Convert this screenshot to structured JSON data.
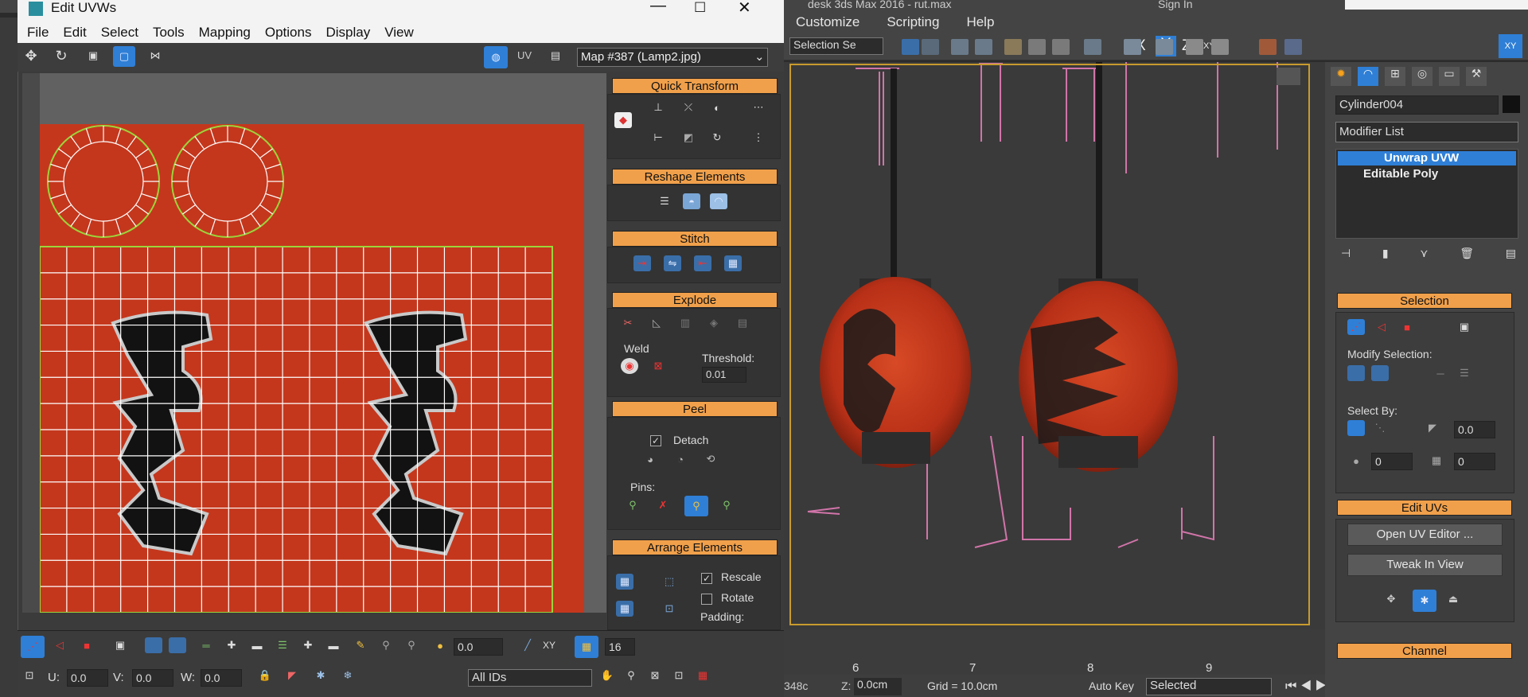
{
  "max": {
    "title_fragment": "desk 3ds Max 2016 - rut.max",
    "signin": "Sign In",
    "menu": [
      "Customize",
      "Scripting",
      "Help"
    ],
    "selection_set": "Selection Se",
    "axes": [
      "X",
      "Y",
      "Z",
      "XY",
      "XY"
    ],
    "timeline_ticks": [
      "6",
      "7",
      "8",
      "9"
    ],
    "status": {
      "x_fragment": "348c",
      "z_label": "Z:",
      "z_value": "0.0cm",
      "grid": "Grid = 10.0cm",
      "autokey": "Auto Key",
      "selected": "Selected"
    }
  },
  "command_panel": {
    "object_name": "Cylinder004",
    "modifier_list": "Modifier List",
    "stack": [
      "Unwrap UVW",
      "Editable Poly"
    ],
    "selection_title": "Selection",
    "modify_selection": "Modify Selection:",
    "select_by": "Select By:",
    "angle_value": "0.0",
    "spin_a": "0",
    "spin_b": "0",
    "edit_uvs_title": "Edit UVs",
    "open_uv_editor": "Open UV Editor ...",
    "tweak_in_view": "Tweak In View",
    "channel_title": "Channel"
  },
  "uvw": {
    "title": "Edit UVWs",
    "menu": [
      "File",
      "Edit",
      "Select",
      "Tools",
      "Mapping",
      "Options",
      "Display",
      "View"
    ],
    "uv_label": "UV",
    "map": "Map #387 (Lamp2.jpg)",
    "rollouts": {
      "quick_transform": "Quick Transform",
      "reshape": "Reshape Elements",
      "stitch": "Stitch",
      "explode": "Explode",
      "weld": "Weld",
      "threshold_label": "Threshold:",
      "threshold_value": "0.01",
      "peel": "Peel",
      "detach": "Detach",
      "pins": "Pins:",
      "arrange": "Arrange Elements",
      "rescale": "Rescale",
      "rotate": "Rotate",
      "padding": "Padding:"
    },
    "bottom": {
      "spin_value": "0.0",
      "xy": "XY",
      "snap_value": "16",
      "u_label": "U:",
      "u_value": "0.0",
      "v_label": "V:",
      "v_value": "0.0",
      "w_label": "W:",
      "w_value": "0.0",
      "ids": "All IDs"
    }
  },
  "colors": {
    "accent": "#f0a04b",
    "active_blue": "#2f7fd6",
    "texture_red": "#c4371d",
    "uv_wire": "#ffffff",
    "uv_edge": "#9cd43a"
  }
}
